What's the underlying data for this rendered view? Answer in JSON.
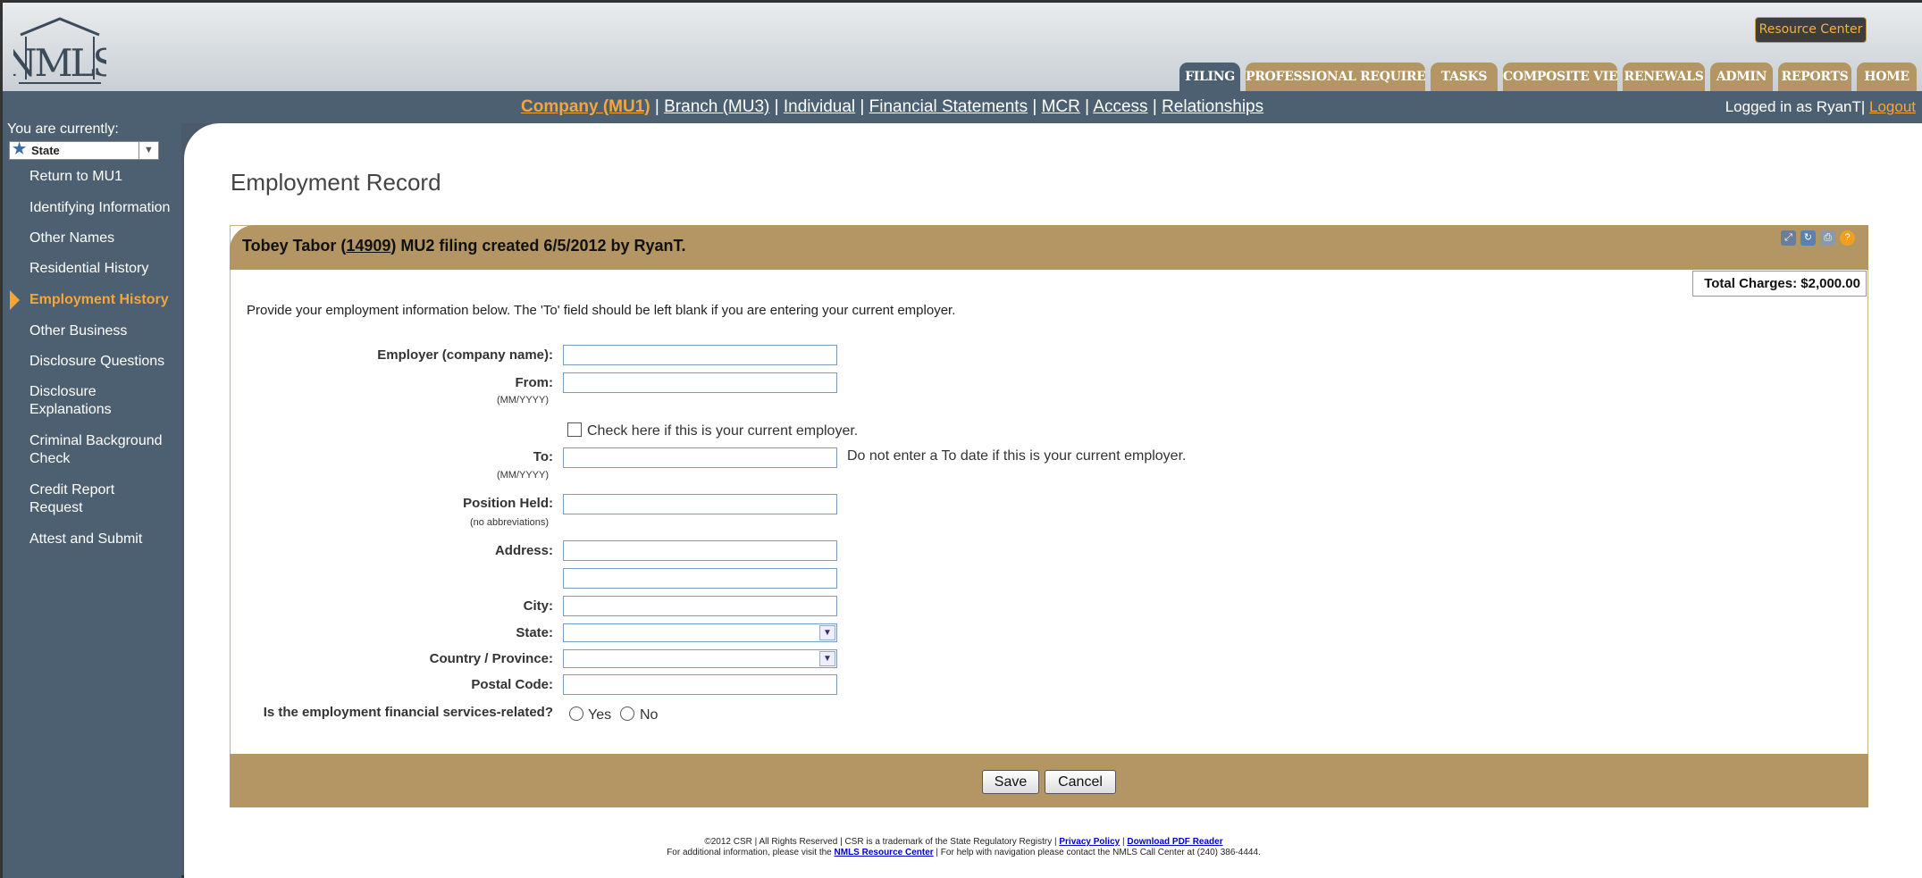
{
  "header": {
    "resource_center": "Resource Center",
    "tabs": [
      {
        "label": "FILING",
        "active": true
      },
      {
        "label": "PROFESSIONAL REQUIREMENTS"
      },
      {
        "label": "TASKS"
      },
      {
        "label": "COMPOSITE VIEW"
      },
      {
        "label": "RENEWALS"
      },
      {
        "label": "ADMIN"
      },
      {
        "label": "REPORTS"
      },
      {
        "label": "HOME"
      }
    ]
  },
  "subnav": {
    "links": [
      "Company (MU1)",
      "Branch (MU3)",
      "Individual",
      "Financial Statements",
      "MCR",
      "Access",
      "Relationships"
    ],
    "separator": " | ",
    "logged_in": "Logged in as RyanT",
    "logout": "Logout"
  },
  "sidebar": {
    "current_label": "You are currently:",
    "state_value": "State",
    "items": [
      "Return to MU1",
      "Identifying Information",
      "Other Names",
      "Residential History",
      "Employment History",
      "Other Business",
      "Disclosure Questions",
      "Disclosure Explanations",
      "Criminal Background Check",
      "Credit Report Request",
      "Attest and Submit"
    ],
    "active_index": 4
  },
  "page": {
    "title": "Employment Record",
    "panel_title_pre": "Tobey Tabor (",
    "panel_title_id": "14909",
    "panel_title_post": ") MU2 filing created 6/5/2012 by RyanT.",
    "total_charges": "Total Charges: $2,000.00",
    "instructions": "Provide your employment information below. The 'To' field should be left blank if you are entering your current employer."
  },
  "form": {
    "employer_label": "Employer (company name):",
    "from_label": "From:",
    "from_hint": "(MM/YYYY)",
    "current_checkbox": "Check here if this is your current employer.",
    "to_label": "To:",
    "to_hint": "(MM/YYYY)",
    "to_note": "Do not enter a To date if this is your current employer.",
    "position_label": "Position Held:",
    "position_hint": "(no abbreviations)",
    "address_label": "Address:",
    "city_label": "City:",
    "state_label": "State:",
    "country_label": "Country / Province:",
    "postal_label": "Postal Code:",
    "financial_question": "Is the employment financial services-related?",
    "yes": "Yes",
    "no": "No"
  },
  "buttons": {
    "save": "Save",
    "cancel": "Cancel"
  },
  "footer": {
    "line1_pre": "©2012 CSR | All Rights Reserved | CSR is a trademark of the State Regulatory Registry | ",
    "privacy": "Privacy Policy",
    "sep": " | ",
    "pdf": "Download PDF Reader",
    "line2_pre": "For additional information, please visit the ",
    "resource": "NMLS Resource Center",
    "line2_post": " | For help with navigation please contact the NMLS Call Center at (240) 386-4444."
  },
  "colors": {
    "accent": "#f5a53a",
    "tan": "#b39663",
    "slate": "#4c6071"
  }
}
